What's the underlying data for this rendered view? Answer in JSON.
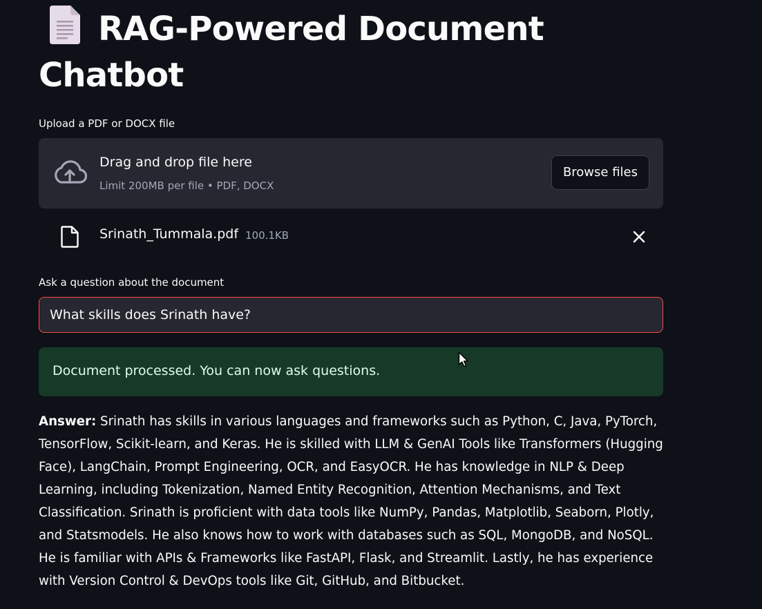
{
  "header": {
    "title": "RAG-Powered Document Chatbot",
    "title_icon": "document-emoji"
  },
  "uploader": {
    "label": "Upload a PDF or DOCX file",
    "drop_title": "Drag and drop file here",
    "drop_subtitle": "Limit 200MB per file • PDF, DOCX",
    "browse_label": "Browse files",
    "icon": "cloud-upload-icon"
  },
  "uploaded_file": {
    "name": "Srinath_Tummala.pdf",
    "size": "100.1KB",
    "icon": "file-icon",
    "remove_icon": "close-icon"
  },
  "question": {
    "label": "Ask a question about the document",
    "value": "What skills does Srinath have?"
  },
  "status": {
    "message": "Document processed. You can now ask questions."
  },
  "answer": {
    "prefix": "Answer:",
    "text": "Srinath has skills in various languages and frameworks such as Python, C, Java, PyTorch, TensorFlow, Scikit-learn, and Keras. He is skilled with LLM & GenAI Tools like Transformers (Hugging Face), LangChain, Prompt Engineering, OCR, and EasyOCR. He has knowledge in NLP & Deep Learning, including Tokenization, Named Entity Recognition, Attention Mechanisms, and Text Classification. Srinath is proficient with data tools like NumPy, Pandas, Matplotlib, Seaborn, Plotly, and Statsmodels. He also knows how to work with databases such as SQL, MongoDB, and NoSQL. He is familiar with APIs & Frameworks like FastAPI, Flask, and Streamlit. Lastly, he has experience with Version Control & DevOps tools like Git, GitHub, and Bitbucket."
  },
  "colors": {
    "background": "#0e1117",
    "panel": "#262730",
    "input_focus_border": "#ff4b4b",
    "success_bg": "#173928",
    "success_text": "#dffde9",
    "muted_text": "#a3a8b8"
  }
}
